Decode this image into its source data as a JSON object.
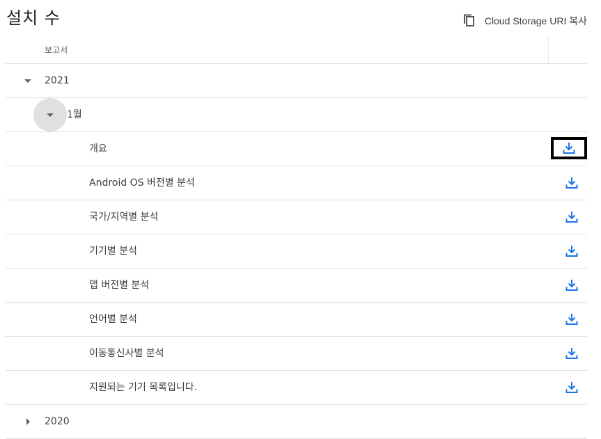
{
  "page": {
    "title": "설치 수",
    "copy_uri_label": "Cloud Storage URI 복사"
  },
  "table": {
    "header": "보고서",
    "years": [
      {
        "label": "2021",
        "expanded": true,
        "months": [
          {
            "label": "1월",
            "expanded": true,
            "reports": [
              "개요",
              "Android OS 버전별 분석",
              "국가/지역별 분석",
              "기기별 분석",
              "앱 버전별 분석",
              "언어별 분석",
              "이동통신사별 분석",
              "지원되는 기기 목록입니다."
            ]
          }
        ]
      },
      {
        "label": "2020",
        "expanded": false
      }
    ]
  },
  "colors": {
    "accent": "#1a73e8",
    "divider": "#e0e0e0",
    "text": "#3c4043",
    "selection_outline": "#000000"
  },
  "icons": {
    "copy": "copy-icon",
    "download": "download-icon",
    "expand": "arrow-drop-down-icon",
    "collapse": "arrow-right-icon"
  }
}
